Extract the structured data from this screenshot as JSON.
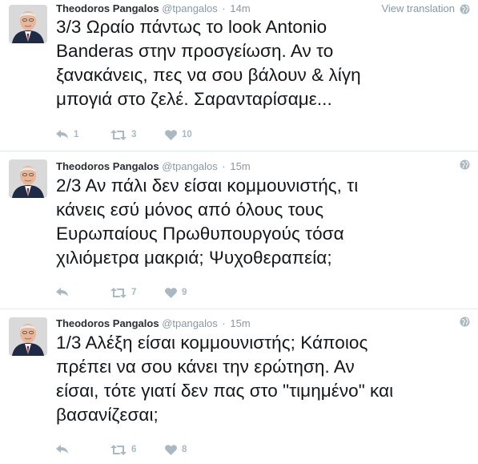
{
  "tweets": [
    {
      "author": "Theodoros Pangalos",
      "handle": "@tpangalos",
      "time": "14m",
      "view_translation": "View translation",
      "lines": [
        "3/3 Ωραίο πάντως το look Antonio",
        "Banderas στην προσγείωση. Αν το",
        "ξανακάνεις, πες να σου βάλουν & λίγη",
        "μπογιά στο ζελέ. Σαρανταρίσαμε..."
      ],
      "reply_count": "1",
      "retweet_count": "3",
      "like_count": "10"
    },
    {
      "author": "Theodoros Pangalos",
      "handle": "@tpangalos",
      "time": "15m",
      "lines": [
        "2/3 Αν πάλι δεν είσαι κομμουνιστής, τι",
        "κάνεις εσύ μόνος από όλους τους",
        "Ευρωπαίους Πρωθυπουργούς τόσα",
        "χιλιόμετρα μακριά; Ψυχοθεραπεία;"
      ],
      "retweet_count": "7",
      "like_count": "9"
    },
    {
      "author": "Theodoros Pangalos",
      "handle": "@tpangalos",
      "time": "15m",
      "lines": [
        "1/3 Αλέξη είσαι κομμουνιστής; Κάποιος",
        "πρέπει να σου κάνει την ερώτηση. Αν",
        "είσαι, τότε γιατί δεν πας στο \"τιμημένο\" και",
        "βασανίζεσαι;"
      ],
      "retweet_count": "6",
      "like_count": "8"
    }
  ],
  "colors": {
    "text": "#14171a",
    "secondary": "#8899a6",
    "action_icon": "#aab8c2",
    "divider": "#e1e8ed"
  },
  "icons": [
    "avatar",
    "globe-icon",
    "reply-icon",
    "retweet-icon",
    "heart-icon"
  ]
}
